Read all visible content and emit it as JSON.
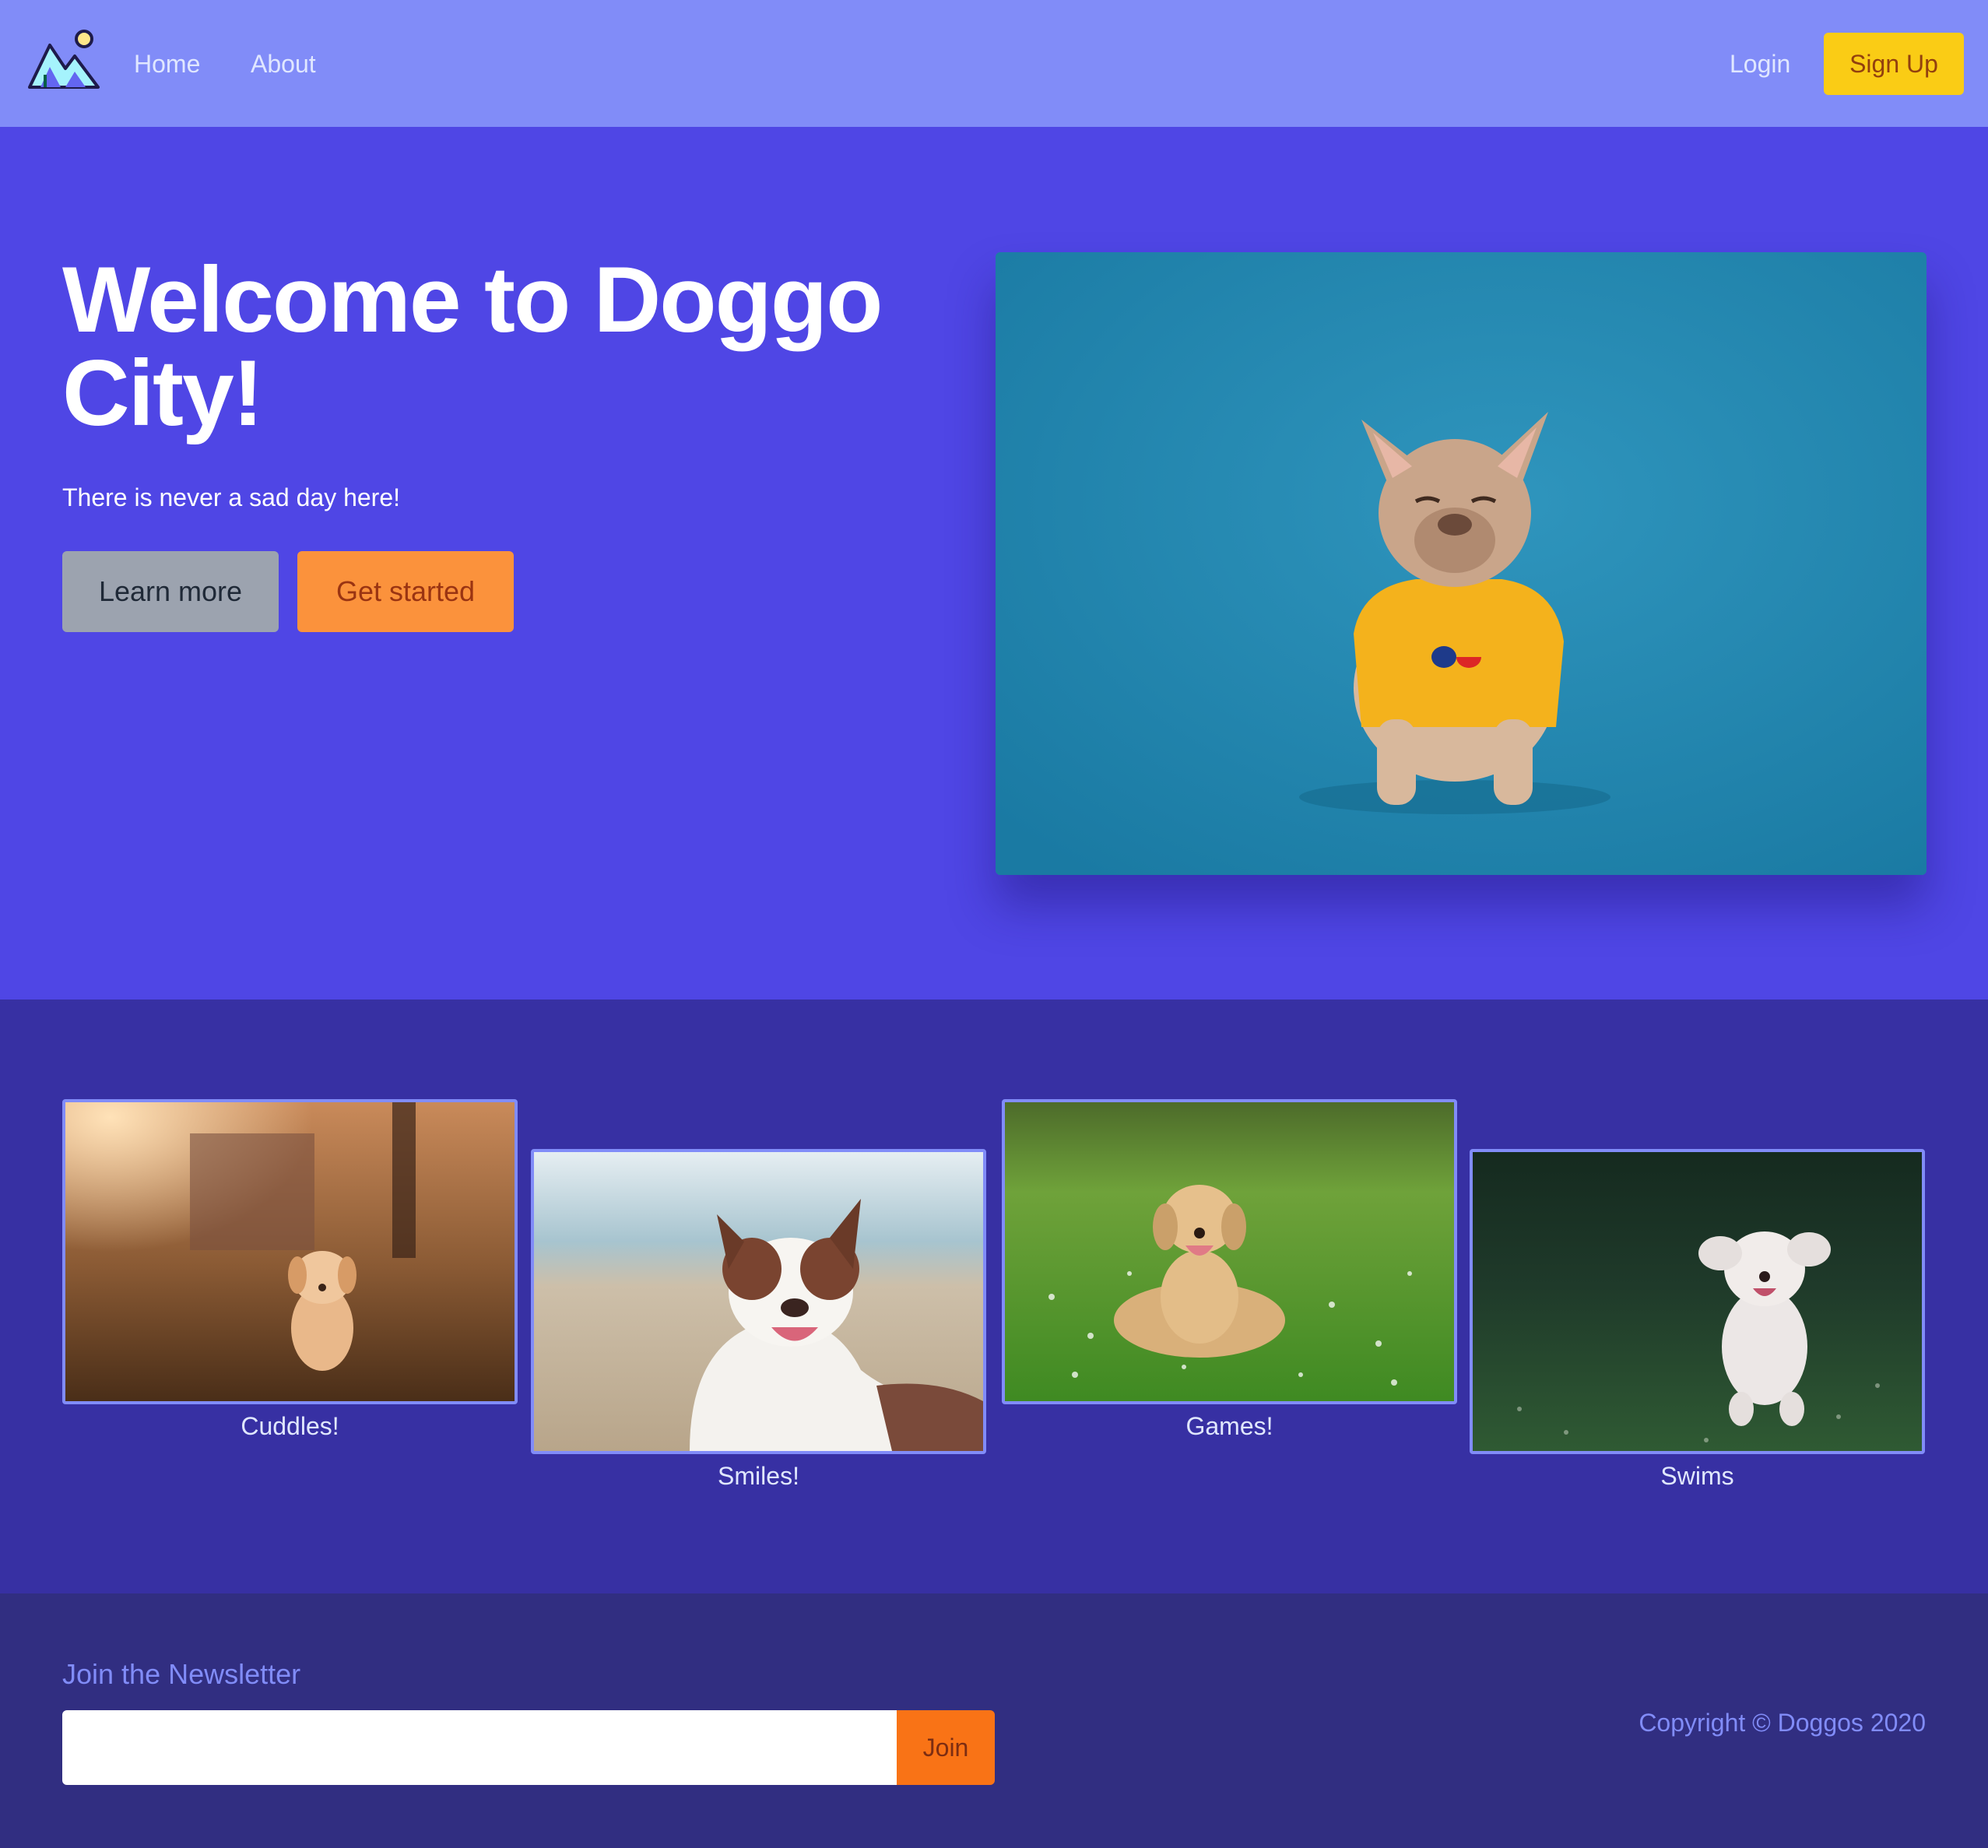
{
  "nav": {
    "logo_icon": "mountain-sun-logo-icon",
    "links": [
      {
        "label": "Home"
      },
      {
        "label": "About"
      }
    ],
    "login_label": "Login",
    "signup_label": "Sign Up"
  },
  "hero": {
    "title": "Welcome to Doggo City!",
    "subtitle": "There is never a sad day here!",
    "learn_more_label": "Learn more",
    "get_started_label": "Get started",
    "image_icon": "french-bulldog-photo"
  },
  "gallery": {
    "items": [
      {
        "caption": "Cuddles!",
        "image": "golden-puppy-photo"
      },
      {
        "caption": "Smiles!",
        "image": "australian-shepherd-photo"
      },
      {
        "caption": "Games!",
        "image": "golden-retriever-photo"
      },
      {
        "caption": "Swims",
        "image": "white-poodle-photo"
      }
    ]
  },
  "footer": {
    "newsletter_title": "Join the Newsletter",
    "newsletter_placeholder": "",
    "join_label": "Join",
    "copyright": "Copyright © Doggos 2020"
  },
  "colors": {
    "nav_bg": "#818cf8",
    "hero_bg": "#4f46e5",
    "gallery_bg": "#3730a3",
    "footer_bg": "#312e81",
    "accent_yellow": "#facc15",
    "accent_orange": "#fb923c"
  }
}
